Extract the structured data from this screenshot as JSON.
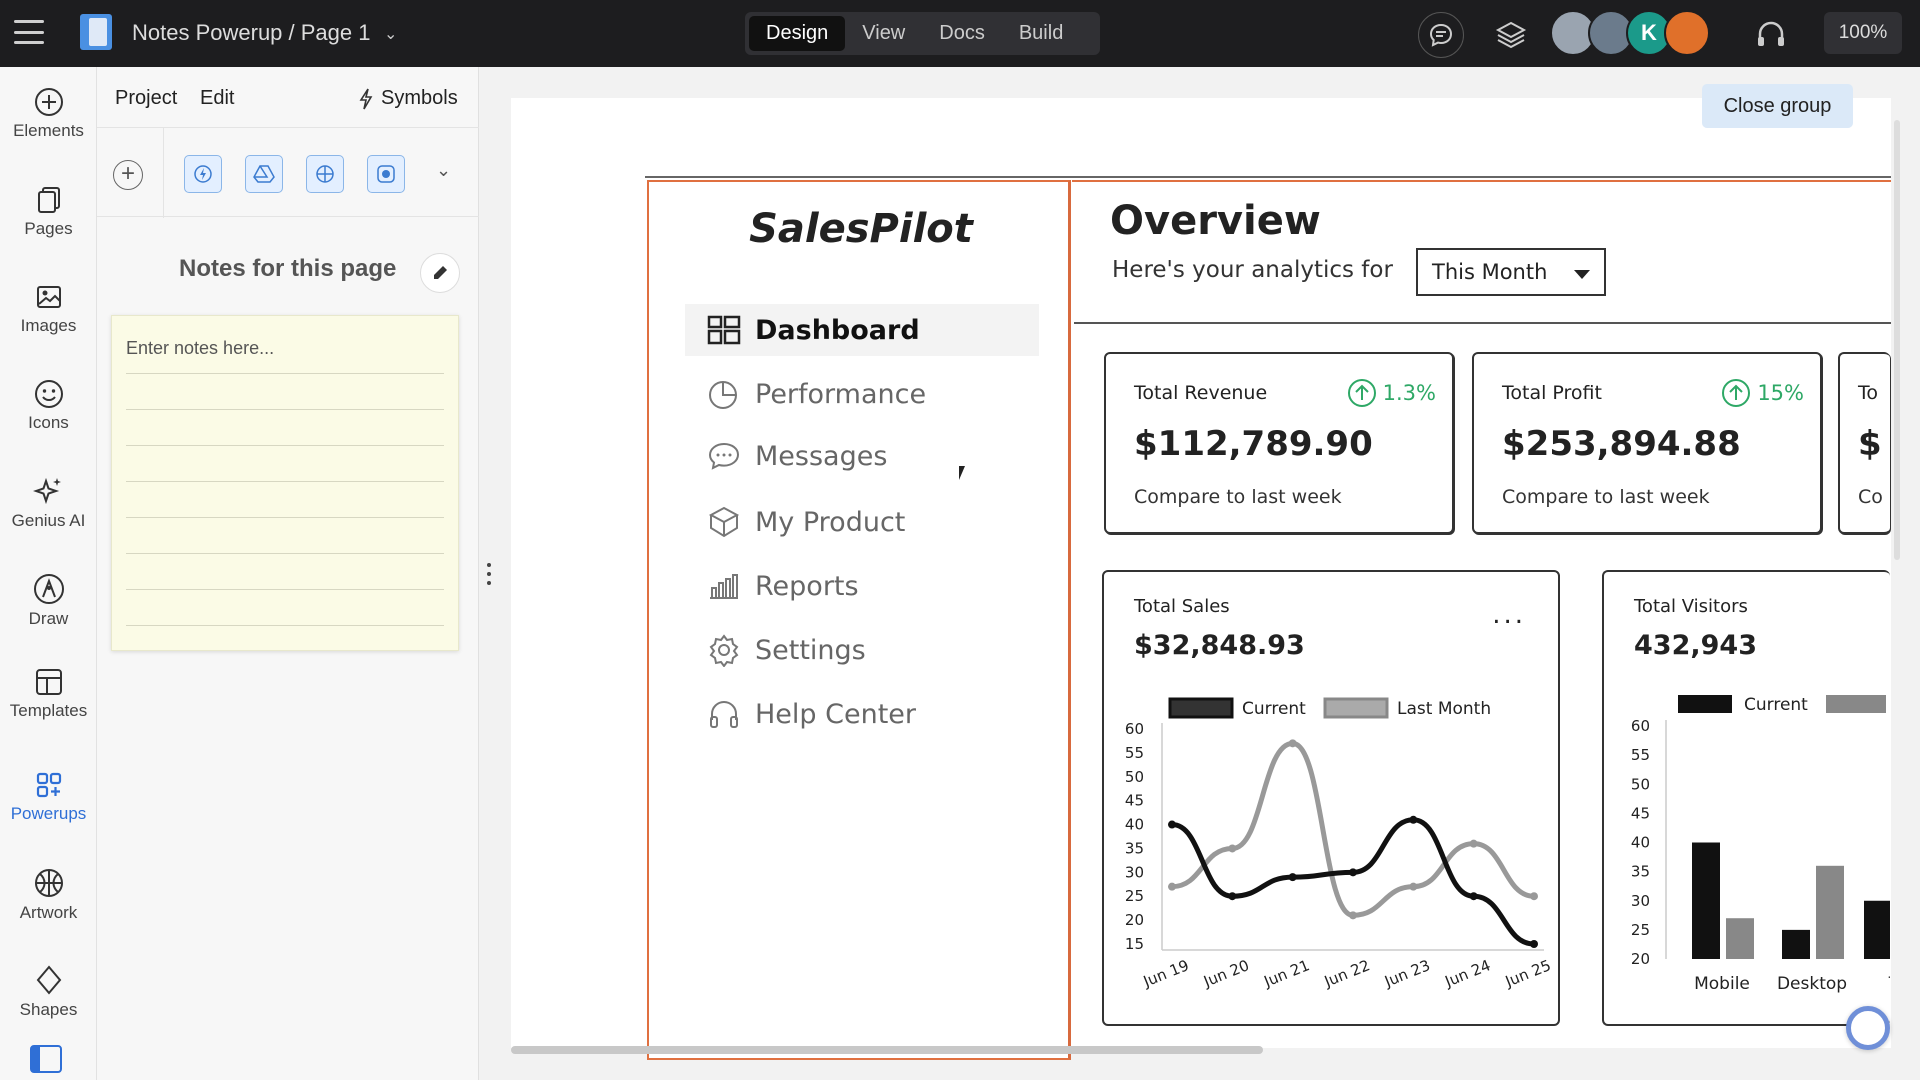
{
  "app": {
    "title": "Notes Powerup / Page 1",
    "modes": [
      "Design",
      "View",
      "Docs",
      "Build"
    ],
    "active_mode": "Design",
    "zoom": "100%",
    "avatar_initial": "K"
  },
  "rail": [
    {
      "label": "Elements",
      "icon": "plus-circle-icon"
    },
    {
      "label": "Pages",
      "icon": "pages-icon"
    },
    {
      "label": "Images",
      "icon": "images-icon"
    },
    {
      "label": "Icons",
      "icon": "smiley-icon"
    },
    {
      "label": "Genius AI",
      "icon": "sparkle-icon"
    },
    {
      "label": "Draw",
      "icon": "pen-icon"
    },
    {
      "label": "Templates",
      "icon": "templates-icon"
    },
    {
      "label": "Powerups",
      "icon": "powerups-icon"
    },
    {
      "label": "Artwork",
      "icon": "globe-icon"
    },
    {
      "label": "Shapes",
      "icon": "diamond-icon"
    }
  ],
  "panel": {
    "menu": [
      "Project",
      "Edit"
    ],
    "symbols": "Symbols",
    "notes_title": "Notes for this page",
    "notes_placeholder": "Enter notes here..."
  },
  "canvas": {
    "close_group": "Close group"
  },
  "wireframe": {
    "logo": "SalesPilot",
    "nav": [
      {
        "label": "Dashboard",
        "active": true
      },
      {
        "label": "Performance"
      },
      {
        "label": "Messages"
      },
      {
        "label": "My Product"
      },
      {
        "label": "Reports"
      },
      {
        "label": "Settings"
      },
      {
        "label": "Help Center"
      }
    ],
    "overview": {
      "title": "Overview",
      "subtitle": "Here's your analytics for",
      "period": "This Month"
    },
    "cards": [
      {
        "label": "Total Revenue",
        "value": "$112,789.90",
        "change": "1.3%",
        "compare": "Compare to last week"
      },
      {
        "label": "Total Profit",
        "value": "$253,894.88",
        "change": "15%",
        "compare": "Compare to last week"
      },
      {
        "label": "To",
        "value": "$",
        "compare": "Co"
      }
    ],
    "sales": {
      "label": "Total Sales",
      "value": "$32,848.93"
    },
    "visitors": {
      "label": "Total Visitors",
      "value": "432,943"
    }
  },
  "chart_data": [
    {
      "type": "line",
      "title": "Total Sales",
      "x": [
        "Jun 19",
        "Jun 20",
        "Jun 21",
        "Jun 22",
        "Jun 23",
        "Jun 24",
        "Jun 25"
      ],
      "yticks": [
        15,
        20,
        25,
        30,
        35,
        40,
        45,
        50,
        55,
        60
      ],
      "ylim": [
        15,
        60
      ],
      "series": [
        {
          "name": "Current",
          "values": [
            40,
            25,
            29,
            30,
            41,
            25,
            15
          ],
          "color": "#111111"
        },
        {
          "name": "Last Month",
          "values": [
            27,
            35,
            57,
            21,
            27,
            36,
            25
          ],
          "color": "#888888"
        }
      ],
      "legend": "top"
    },
    {
      "type": "bar",
      "title": "Total Visitors",
      "categories": [
        "Mobile",
        "Desktop",
        "T"
      ],
      "yticks": [
        20,
        25,
        30,
        35,
        40,
        45,
        50,
        55,
        60
      ],
      "ylim": [
        20,
        60
      ],
      "series": [
        {
          "name": "Current",
          "values": [
            40,
            25,
            30
          ],
          "color": "#111111"
        },
        {
          "name": "",
          "values": [
            27,
            36,
            0
          ],
          "color": "#888888"
        }
      ],
      "legend": "top"
    }
  ]
}
